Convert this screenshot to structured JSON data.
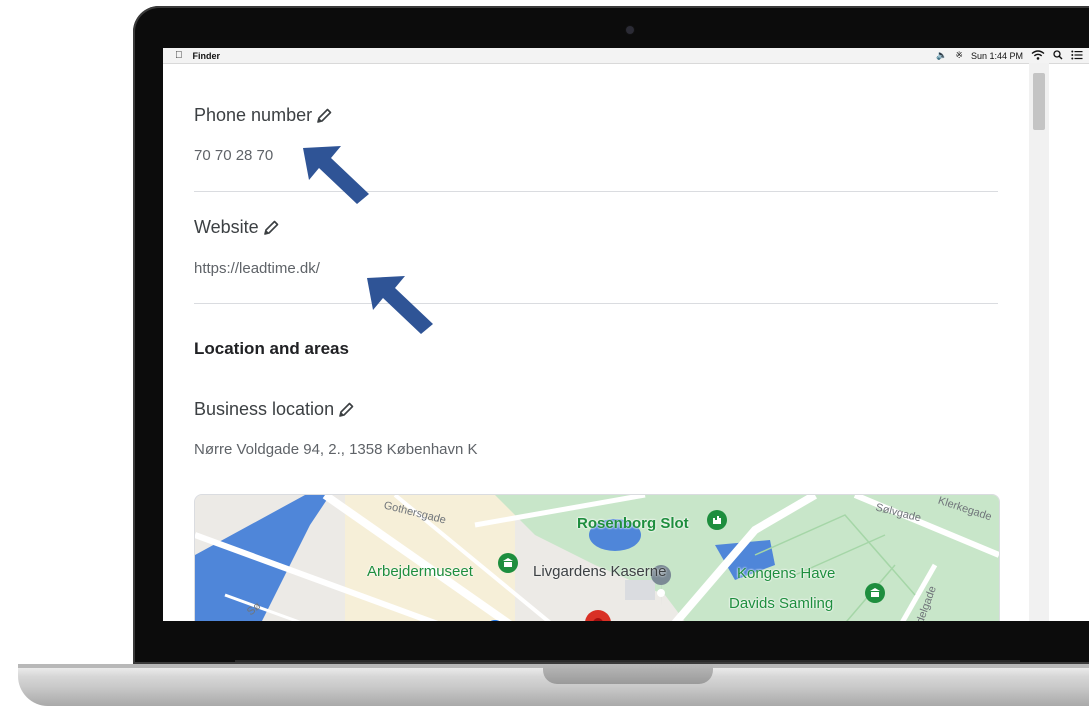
{
  "menubar": {
    "app_name": "Finder",
    "clock": "Sun 1:44 PM"
  },
  "fields": {
    "phone": {
      "label": "Phone number",
      "value": "70 70 28 70"
    },
    "website": {
      "label": "Website",
      "value": "https://leadtime.dk/"
    }
  },
  "location": {
    "section_title": "Location and areas",
    "business_label": "Business location",
    "address": "Nørre Voldgade 94, 2., 1358 København K"
  },
  "map": {
    "places": [
      "Rosenborg Slot",
      "Arbejdermuseet",
      "Livgardens Kaserne",
      "Kongens Have",
      "Davids Samling"
    ],
    "roads": [
      "Gothersgade",
      "Sølvgade",
      "Klerkegade",
      "Sø",
      "delgade"
    ]
  },
  "colors": {
    "annotation_arrow": "#2f5496",
    "map_green": "#1e8e3e",
    "map_park": "#c8e6c9",
    "map_water": "#4f86d9",
    "map_pin": "#d93025"
  },
  "icons": [
    "apple-icon",
    "volume-icon",
    "bluetooth-icon",
    "wifi-icon",
    "spotlight-icon",
    "notification-center-icon",
    "pencil-icon",
    "museum-icon",
    "castle-icon",
    "map-pin-icon"
  ]
}
